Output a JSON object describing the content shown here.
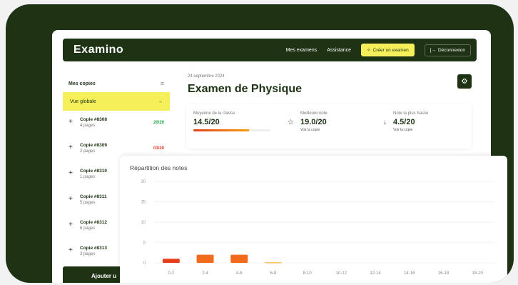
{
  "app": {
    "logo": "Examino"
  },
  "nav": {
    "my_exams": "Mes examens",
    "assistance": "Assistance",
    "create_icon": "sparkle-icon",
    "create_label": "Créer un examen",
    "logout_icon": "logout-icon",
    "logout_label": "Déconnexion"
  },
  "sidebar": {
    "title": "Mes copies",
    "global_label": "Vue globale",
    "copies": [
      {
        "name": "Copie #8308",
        "pages": "4 pages",
        "grade": "20/20",
        "grade_color": "#22a04b"
      },
      {
        "name": "Copie #8309",
        "pages": "2 pages",
        "grade": "03/20",
        "grade_color": "#e03a2e"
      },
      {
        "name": "Copie #8310",
        "pages": "1 pages",
        "grade": "",
        "grade_color": "#22a04b"
      },
      {
        "name": "Copie #8311",
        "pages": "5 pages",
        "grade": "",
        "grade_color": "#22a04b"
      },
      {
        "name": "Copie #8312",
        "pages": "6 pages",
        "grade": "",
        "grade_color": "#22a04b"
      },
      {
        "name": "Copie #8313",
        "pages": "3 pages",
        "grade": "",
        "grade_color": "#22a04b"
      }
    ],
    "add_label": "Ajouter u"
  },
  "exam": {
    "date": "24 septembre 2024",
    "title": "Examen de Physique",
    "stats": {
      "average_label": "Moyenne de la classe",
      "average_value": "14.5/20",
      "average_fraction": 0.725,
      "best_label": "Meilleure note",
      "best_value": "19.0/20",
      "best_link": "Voir la copie",
      "worst_label": "Note la plus basse",
      "worst_value": "4.5/20",
      "worst_link": "Voir la copie"
    }
  },
  "colors": {
    "brand_dark": "#1e3214",
    "accent_yellow": "#f5f05a",
    "bar_red": "#e53e1a",
    "bar_orange": "#f26a1b"
  },
  "chart_data": {
    "type": "bar",
    "title": "Répartition des notes",
    "categories": [
      "0-2",
      "2-4",
      "4-6",
      "6-8",
      "8-10",
      "10-12",
      "12-14",
      "14-16",
      "16-18",
      "18-20"
    ],
    "values": [
      1,
      2,
      2,
      0.1,
      0,
      0,
      0,
      0,
      0,
      0
    ],
    "ylim": [
      0,
      20
    ],
    "yticks": [
      0,
      5,
      10,
      15,
      20
    ],
    "bar_colors": [
      "#e53e1a",
      "#f26a1b",
      "#f26a1b",
      "#f59e0b",
      "#f59e0b",
      "#f59e0b",
      "#f59e0b",
      "#f59e0b",
      "#f59e0b",
      "#f59e0b"
    ]
  }
}
